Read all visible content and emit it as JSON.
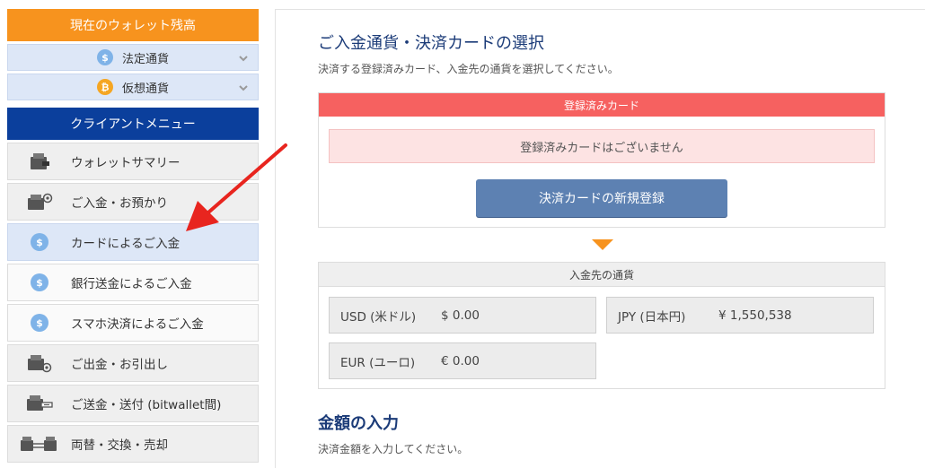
{
  "sidebar": {
    "wallet_header": "現在のウォレット残高",
    "currency_rows": [
      {
        "label": "法定通貨",
        "icon": "dollar-coin-icon",
        "coin_glyph": "$",
        "color": "#7fb3e8"
      },
      {
        "label": "仮想通貨",
        "icon": "bitcoin-coin-icon",
        "coin_glyph": "₿",
        "color": "#f5a623"
      }
    ],
    "menu_header": "クライアントメニュー",
    "menu_items": [
      {
        "label": "ウォレットサマリー",
        "icon": "wallet-icon"
      },
      {
        "label": "ご入金・お預かり",
        "icon": "wallet-deposit-icon"
      },
      {
        "label": "カードによるご入金",
        "icon": "dollar-coin-icon",
        "active": true
      },
      {
        "label": "銀行送金によるご入金",
        "icon": "dollar-coin-icon"
      },
      {
        "label": "スマホ決済によるご入金",
        "icon": "dollar-coin-icon"
      },
      {
        "label": "ご出金・お引出し",
        "icon": "wallet-withdraw-icon"
      },
      {
        "label": "ご送金・送付 (bitwallet間)",
        "icon": "wallet-transfer-icon"
      },
      {
        "label": "両替・交換・売却",
        "icon": "wallet-exchange-icon"
      }
    ]
  },
  "main": {
    "card_section": {
      "title": "ご入金通貨・決済カードの選択",
      "description": "決済する登録済みカード、入金先の通貨を選択してください。",
      "registered_cards_header": "登録済みカード",
      "no_cards_message": "登録済みカードはございません",
      "register_button": "決済カードの新規登録"
    },
    "currency_section": {
      "header": "入金先の通貨",
      "currencies": [
        {
          "code": "USD (米ドル)",
          "balance": "$ 0.00"
        },
        {
          "code": "JPY (日本円)",
          "balance": "¥ 1,550,538"
        },
        {
          "code": "EUR (ユーロ)",
          "balance": "€ 0.00"
        }
      ]
    },
    "amount_section": {
      "title": "金額の入力",
      "description": "決済金額を入力してください。"
    }
  },
  "colors": {
    "wallet_header": "#f7931e",
    "menu_header": "#0b3f9c",
    "cards_header": "#f66160",
    "register_button": "#5d81b2",
    "annotation_arrow": "#e8251f"
  }
}
